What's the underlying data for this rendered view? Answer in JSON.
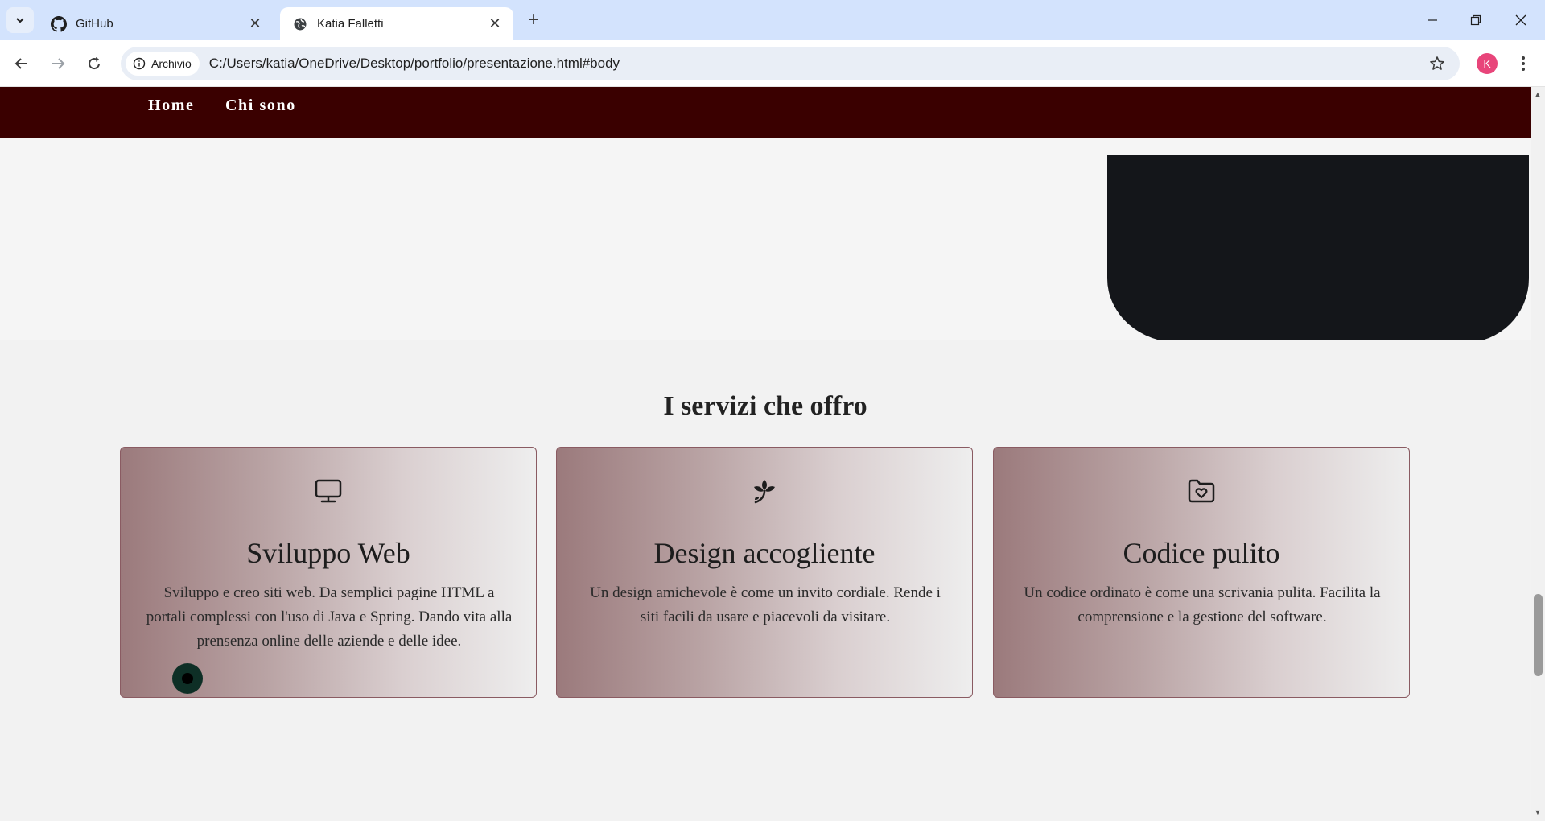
{
  "browser": {
    "tabs": [
      {
        "title": "GitHub",
        "active": false,
        "icon": "github-icon"
      },
      {
        "title": "Katia Falletti",
        "active": true,
        "icon": "globe-icon"
      }
    ],
    "site_info_label": "Archivio",
    "url": "C:/Users/katia/OneDrive/Desktop/portfolio/presentazione.html#body",
    "profile_initial": "K",
    "profile_color": "#e8457a"
  },
  "page": {
    "nav": [
      {
        "label": "Home"
      },
      {
        "label": "Chi sono"
      }
    ],
    "services_title": "I servizi che offro",
    "cards": [
      {
        "icon": "monitor-icon",
        "title": "Sviluppo Web",
        "text": "Sviluppo e creo siti web. Da semplici pagine HTML a portali complessi con l'uso di Java e Spring. Dando vita alla prensenza online delle aziende e delle idee."
      },
      {
        "icon": "flower-icon",
        "title": "Design accogliente",
        "text": "Un design amichevole è come un invito cordiale. Rende i siti facili da usare e piacevoli da visitare."
      },
      {
        "icon": "folder-heart-icon",
        "title": "Codice pulito",
        "text": "Un codice ordinato è come una scrivania pulita. Facilita la comprensione e la gestione del software."
      }
    ],
    "colors": {
      "navbar": "#3a0000",
      "card_gradient_start": "#9b7a7c",
      "card_gradient_end": "#eeeeee",
      "fab": "#0e2f26"
    }
  }
}
